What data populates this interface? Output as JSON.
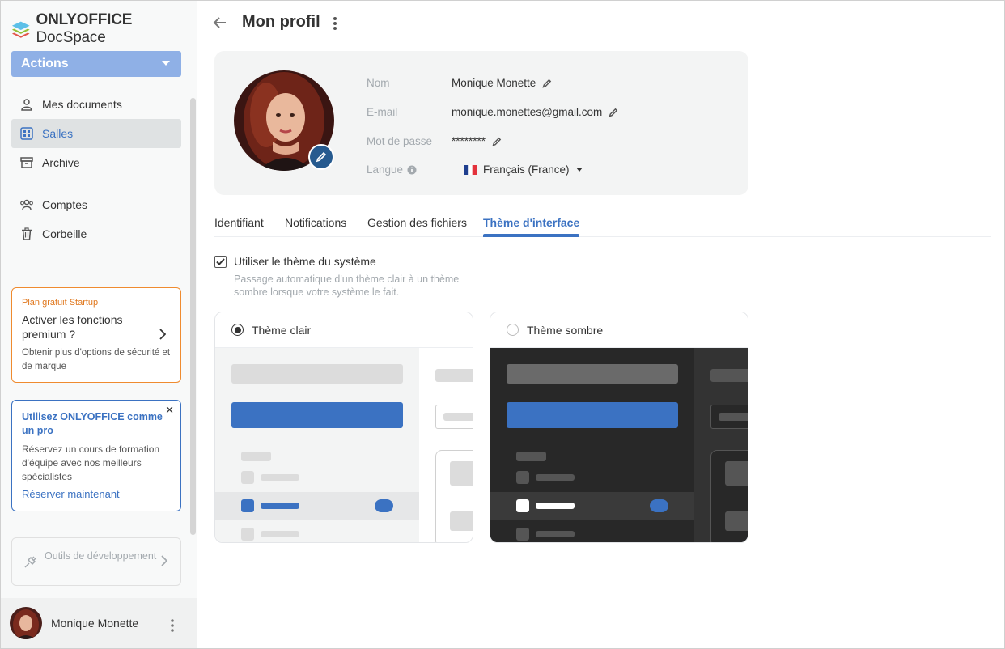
{
  "app": {
    "logo_bold": "ONLYOFFICE",
    "logo_light": "DocSpace"
  },
  "sidebar": {
    "actions_label": "Actions",
    "items": [
      {
        "label": "Mes documents",
        "icon": "person-icon"
      },
      {
        "label": "Salles",
        "icon": "rooms-icon"
      },
      {
        "label": "Archive",
        "icon": "archive-icon"
      },
      {
        "label": "Comptes",
        "icon": "accounts-icon"
      },
      {
        "label": "Corbeille",
        "icon": "trash-icon"
      }
    ],
    "startup_card": {
      "small": "Plan gratuit Startup",
      "title": "Activer les fonctions premium ?",
      "desc": "Obtenir plus d'options de sécurité et de marque"
    },
    "pro_card": {
      "title": "Utilisez ONLYOFFICE comme un pro",
      "desc": "Réservez un cours de formation d'équipe avec nos meilleurs spécialistes",
      "link": "Réserver maintenant"
    },
    "dev_card": {
      "label": "Outils de développement"
    },
    "user_name": "Monique Monette"
  },
  "main": {
    "title": "Mon profil",
    "profile": {
      "name_label": "Nom",
      "name_value": "Monique Monette",
      "email_label": "E-mail",
      "email_value": "monique.monettes@gmail.com",
      "password_label": "Mot de passe",
      "password_value": "********",
      "language_label": "Langue",
      "language_value": "Français (France)"
    },
    "tabs": [
      "Identifiant",
      "Notifications",
      "Gestion des fichiers",
      "Thème d'interface"
    ],
    "active_tab": "Thème d'interface",
    "system_theme": {
      "label": "Utiliser le thème du système",
      "checked": true,
      "desc": "Passage automatique d'un thème clair à un thème sombre lorsque votre système le fait."
    },
    "themes": [
      {
        "label": "Thème clair",
        "selected": true
      },
      {
        "label": "Thème sombre",
        "selected": false
      }
    ]
  },
  "colors": {
    "accent": "#3b72c2",
    "actions_button": "#8fb0e6",
    "startup_border": "#ef8b2f",
    "dark_preview": "#333333"
  }
}
